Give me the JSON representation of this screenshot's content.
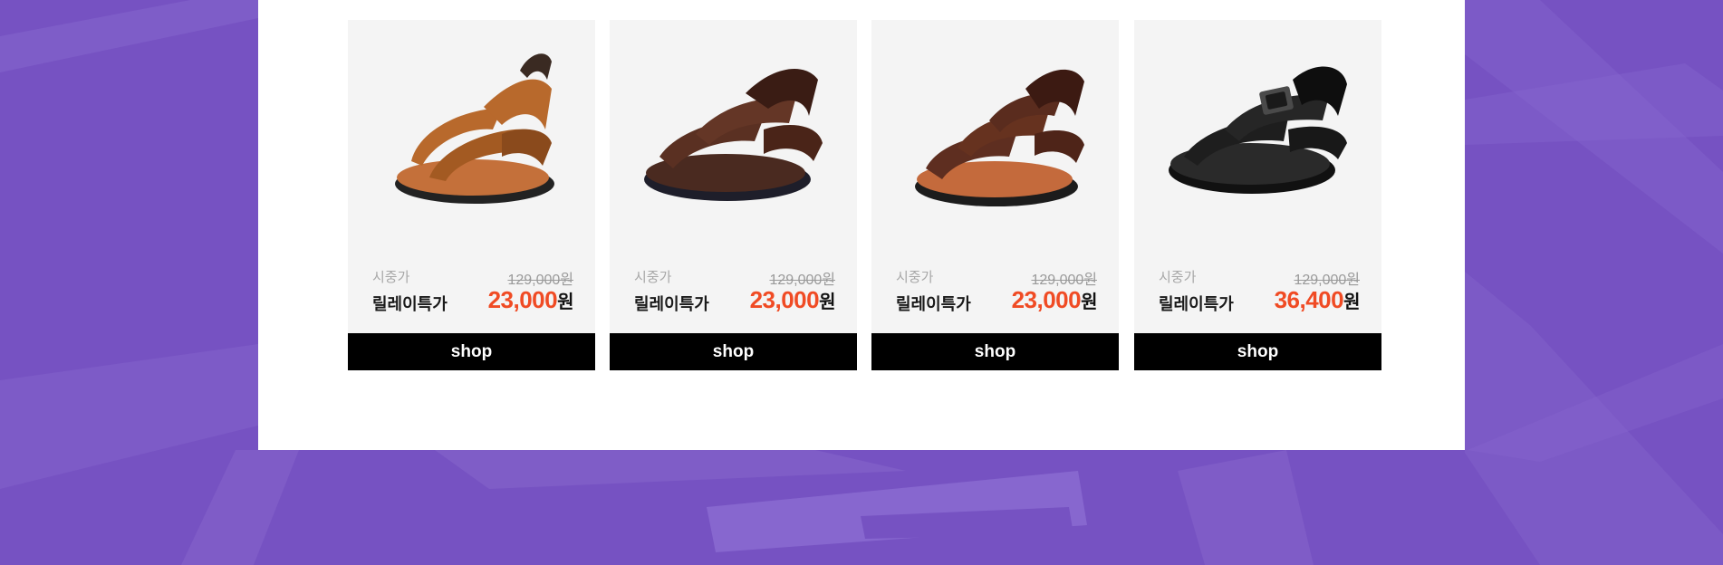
{
  "products": [
    {
      "name": "tan-sandal",
      "msrp_label": "시중가",
      "msrp_price": "129,000원",
      "special_label": "릴레이특가",
      "special_price": "23,000",
      "currency": "원",
      "button_label": "shop",
      "colors": {
        "upper": "#b8692c",
        "upper_dark": "#8a4a1c",
        "sole": "#c4703a"
      }
    },
    {
      "name": "brown-sandal",
      "msrp_label": "시중가",
      "msrp_price": "129,000원",
      "special_label": "릴레이특가",
      "special_price": "23,000",
      "currency": "원",
      "button_label": "shop",
      "colors": {
        "upper": "#5a3022",
        "upper_dark": "#3a1c14",
        "sole": "#5a3022"
      }
    },
    {
      "name": "brown-orange-sandal",
      "msrp_label": "시중가",
      "msrp_price": "129,000원",
      "special_label": "릴레이특가",
      "special_price": "23,000",
      "currency": "원",
      "button_label": "shop",
      "colors": {
        "upper": "#5e2e20",
        "upper_dark": "#3c1a12",
        "sole": "#c46a3c"
      }
    },
    {
      "name": "black-sandal",
      "msrp_label": "시중가",
      "msrp_price": "129,000원",
      "special_label": "릴레이특가",
      "special_price": "36,400",
      "currency": "원",
      "button_label": "shop",
      "colors": {
        "upper": "#222222",
        "upper_dark": "#0e0e0e",
        "sole": "#1c1c1c"
      }
    }
  ],
  "theme": {
    "background": "#7652c2",
    "price_accent": "#f04b24"
  }
}
